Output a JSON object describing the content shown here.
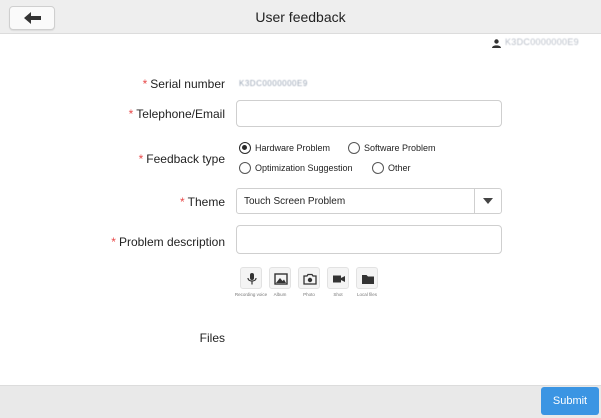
{
  "header": {
    "title": "User feedback"
  },
  "user": {
    "id": "K3DC0000000E9"
  },
  "form": {
    "serial": {
      "label": "Serial number",
      "value": "K3DC0000000E9"
    },
    "contact": {
      "label": "Telephone/Email",
      "value": ""
    },
    "feedback_type": {
      "label": "Feedback type",
      "options": [
        "Hardware Problem",
        "Software Problem",
        "Optimization Suggestion",
        "Other"
      ],
      "selected": "Hardware Problem"
    },
    "theme": {
      "label": "Theme",
      "selected": "Touch Screen Problem"
    },
    "description": {
      "label": "Problem description",
      "value": ""
    },
    "tools": [
      "Recording voice",
      "Album",
      "Photo",
      "Shot",
      "Local files"
    ],
    "files_label": "Files",
    "required_mark": "*"
  },
  "footer": {
    "submit_label": "Submit"
  },
  "colors": {
    "accent": "#3b95e3",
    "required": "#e84a4a",
    "header_bg": "#eeeeee",
    "footer_bg": "#e9e9e9"
  },
  "icons": [
    "back-arrow-icon",
    "user-icon",
    "microphone-icon",
    "image-icon",
    "camera-icon",
    "video-camera-icon",
    "folder-icon",
    "chevron-down-icon"
  ]
}
